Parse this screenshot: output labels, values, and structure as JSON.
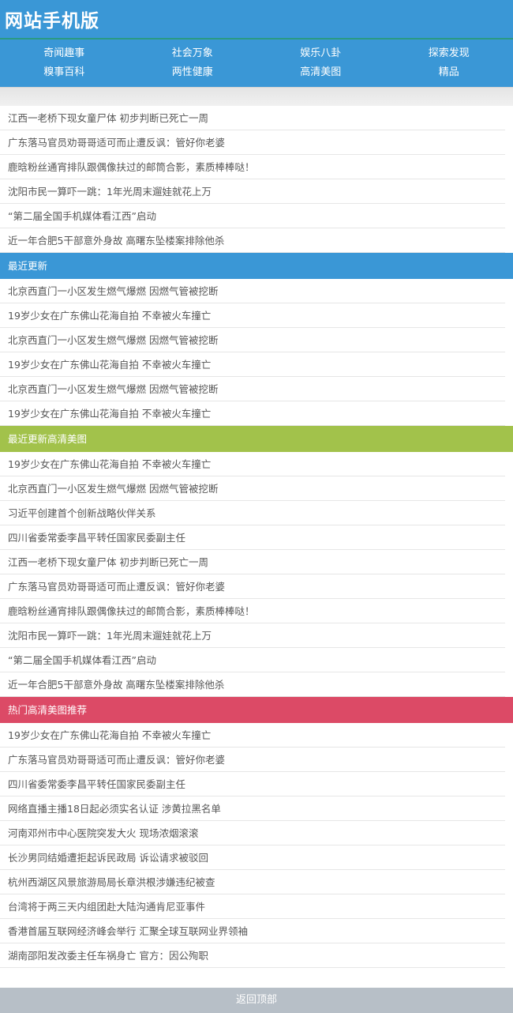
{
  "header": {
    "title": "网站手机版"
  },
  "nav": [
    "奇闻趣事",
    "社会万象",
    "娱乐八卦",
    "探索发现",
    "糗事百科",
    "两性健康",
    "高清美图",
    "精品"
  ],
  "list_top": [
    "江西一老桥下现女童尸体 初步判断已死亡一周",
    "广东落马官员劝哥哥适可而止遭反讽：管好你老婆",
    "鹿晗粉丝通宵排队跟偶像扶过的邮筒合影，素质棒棒哒！",
    "沈阳市民一算吓一跳：1年光周末遛娃就花上万",
    "“第二届全国手机媒体看江西”启动",
    "近一年合肥5干部意外身故 高曙东坠楼案排除他杀"
  ],
  "section_latest": {
    "title": "最近更新",
    "items": [
      "北京西直门一小区发生燃气爆燃 因燃气管被挖断",
      "19岁少女在广东佛山花海自拍 不幸被火车撞亡",
      "北京西直门一小区发生燃气爆燃 因燃气管被挖断",
      "19岁少女在广东佛山花海自拍 不幸被火车撞亡",
      "北京西直门一小区发生燃气爆燃 因燃气管被挖断",
      "19岁少女在广东佛山花海自拍 不幸被火车撞亡"
    ]
  },
  "section_hd": {
    "title": "最近更新高清美图",
    "items": [
      "19岁少女在广东佛山花海自拍 不幸被火车撞亡",
      "北京西直门一小区发生燃气爆燃 因燃气管被挖断",
      "习近平创建首个创新战略伙伴关系",
      "四川省委常委李昌平转任国家民委副主任",
      "江西一老桥下现女童尸体 初步判断已死亡一周",
      "广东落马官员劝哥哥适可而止遭反讽：管好你老婆",
      "鹿晗粉丝通宵排队跟偶像扶过的邮筒合影，素质棒棒哒！",
      "沈阳市民一算吓一跳：1年光周末遛娃就花上万",
      "“第二届全国手机媒体看江西”启动",
      "近一年合肥5干部意外身故 高曙东坠楼案排除他杀"
    ]
  },
  "section_hot": {
    "title": "热门高清美图推荐",
    "items": [
      "19岁少女在广东佛山花海自拍 不幸被火车撞亡",
      "广东落马官员劝哥哥适可而止遭反讽：管好你老婆",
      "四川省委常委李昌平转任国家民委副主任",
      "网络直播主播18日起必须实名认证 涉黄拉黑名单",
      "河南邓州市中心医院突发大火 现场浓烟滚滚",
      "长沙男同结婚遭拒起诉民政局 诉讼请求被驳回",
      "杭州西湖区风景旅游局局长章洪根涉嫌违纪被查",
      "台湾将于两三天内组团赴大陆沟通肯尼亚事件",
      "香港首届互联网经济峰会举行 汇聚全球互联网业界领袖",
      "湖南邵阳发改委主任车祸身亡 官方：因公殉职"
    ]
  },
  "footer": {
    "back_to_top": "返回顶部"
  }
}
